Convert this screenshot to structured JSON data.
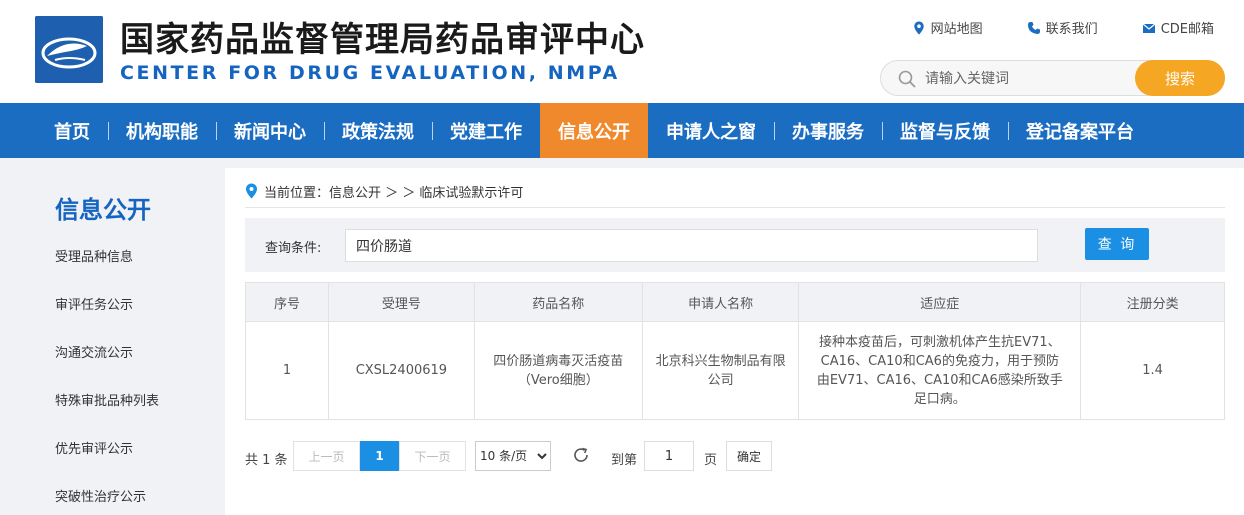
{
  "header": {
    "title_cn": "国家药品监督管理局药品审评中心",
    "title_en": "CENTER FOR DRUG EVALUATION, NMPA",
    "top_links": [
      {
        "label": "网站地图",
        "icon": "location-pin-icon"
      },
      {
        "label": "联系我们",
        "icon": "phone-icon"
      },
      {
        "label": "CDE邮箱",
        "icon": "mail-icon"
      }
    ],
    "search": {
      "placeholder": "请输入关键词",
      "button_label": "搜索"
    }
  },
  "nav": {
    "items": [
      "首页",
      "机构职能",
      "新闻中心",
      "政策法规",
      "党建工作",
      "信息公开",
      "申请人之窗",
      "办事服务",
      "监督与反馈",
      "登记备案平台"
    ],
    "active": "信息公开"
  },
  "sidebar": {
    "title": "信息公开",
    "items": [
      "受理品种信息",
      "审评任务公示",
      "沟通交流公示",
      "特殊审批品种列表",
      "优先审评公示",
      "突破性治疗公示"
    ]
  },
  "breadcrumb": {
    "text": "当前位置：信息公开 ＞ ＞ 临床试验默示许可"
  },
  "query": {
    "label": "查询条件:",
    "value": "四价肠道",
    "button_label": "查 询"
  },
  "table": {
    "headers": [
      "序号",
      "受理号",
      "药品名称",
      "申请人名称",
      "适应症",
      "注册分类"
    ],
    "rows": [
      {
        "index": "1",
        "acceptance_no": "CXSL2400619",
        "drug_name": "四价肠道病毒灭活疫苗（Vero细胞）",
        "applicant": "北京科兴生物制品有限公司",
        "indication": "接种本疫苗后，可刺激机体产生抗EV71、CA16、CA10和CA6的免疫力，用于预防由EV71、CA16、CA10和CA6感染所致手足口病。",
        "category": "1.4"
      }
    ]
  },
  "pager": {
    "total": "共 1 条",
    "prev": "上一页",
    "current": "1",
    "next": "下一页",
    "page_size": "10 条/页",
    "goto_label": "到第",
    "goto_value": "1",
    "page_unit": "页",
    "confirm": "确定"
  },
  "colors": {
    "nav_bg": "#1b6dc1",
    "nav_active": "#f0892b",
    "search_btn": "#f5a623",
    "accent_blue": "#1a8fe3",
    "title_en": "#1565c0"
  }
}
